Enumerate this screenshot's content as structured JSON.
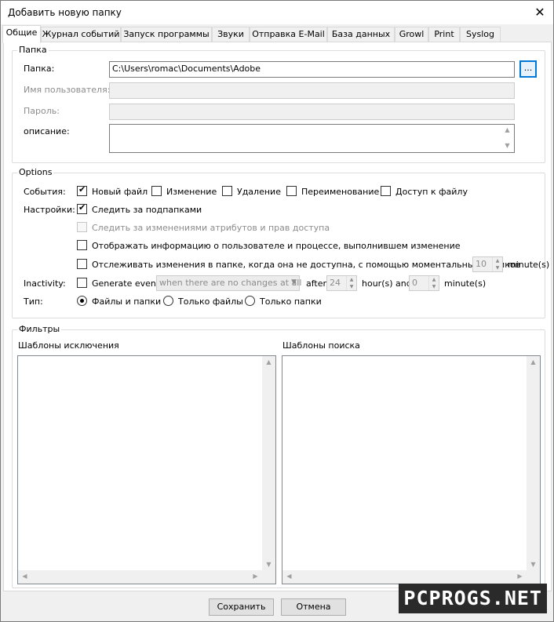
{
  "window": {
    "title": "Добавить новую папку",
    "close_glyph": "✕"
  },
  "tabs": [
    "Общие",
    "Журнал событий",
    "Запуск программы",
    "Звуки",
    "Отправка E-Mail",
    "База данных",
    "Growl",
    "Print",
    "Syslog"
  ],
  "folder_group": {
    "label": "Папка",
    "folder_label": "Папка:",
    "folder_value": "C:\\Users\\romac\\Documents\\Adobe",
    "browse_label": "...",
    "user_label": "Имя пользователя:",
    "user_value": "",
    "password_label": "Пароль:",
    "password_value": "",
    "description_label": "описание:",
    "description_value": ""
  },
  "options_group": {
    "label": "Options",
    "events_label": "События:",
    "events": [
      {
        "label": "Новый файл",
        "checked": true
      },
      {
        "label": "Изменение",
        "checked": false
      },
      {
        "label": "Удаление",
        "checked": false
      },
      {
        "label": "Переименование",
        "checked": false
      },
      {
        "label": "Доступ к файлу",
        "checked": false
      }
    ],
    "settings_label": "Настройки:",
    "subfolders_label": "Следить за подпапками",
    "attributes_label": "Следить за изменениями атрибутов и прав доступа",
    "userinfo_label": "Отображать информацию о пользователе и процессе, выполнившем изменение",
    "snapshots_label": "Отслеживать изменения в папке, когда она не доступна, с помощью моментальных снимков",
    "snapshots_value": "10",
    "snapshots_unit": "minute(s)",
    "inactivity_label": "Inactivity:",
    "generate_event_label": "Generate event",
    "inactivity_condition": "when there are no changes at all",
    "after_label": "after",
    "hours_value": "24",
    "hours_unit": "hour(s) and",
    "minutes_value": "0",
    "minutes_unit": "minute(s)",
    "type_label": "Тип:",
    "types": [
      {
        "label": "Файлы и папки",
        "selected": true
      },
      {
        "label": "Только файлы",
        "selected": false
      },
      {
        "label": "Только папки",
        "selected": false
      }
    ]
  },
  "filters_group": {
    "label": "Фильтры",
    "exclude_label": "Шаблоны исключения",
    "search_label": "Шаблоны поиска"
  },
  "buttons": {
    "save": "Сохранить",
    "cancel": "Отмена"
  },
  "watermark": "PCPROGS.NET",
  "icons": {
    "check": "check-icon",
    "close": "close-icon",
    "scroll_up": "scroll-up-icon",
    "scroll_down": "scroll-down-icon",
    "scroll_left": "scroll-left-icon",
    "scroll_right": "scroll-right-icon"
  }
}
